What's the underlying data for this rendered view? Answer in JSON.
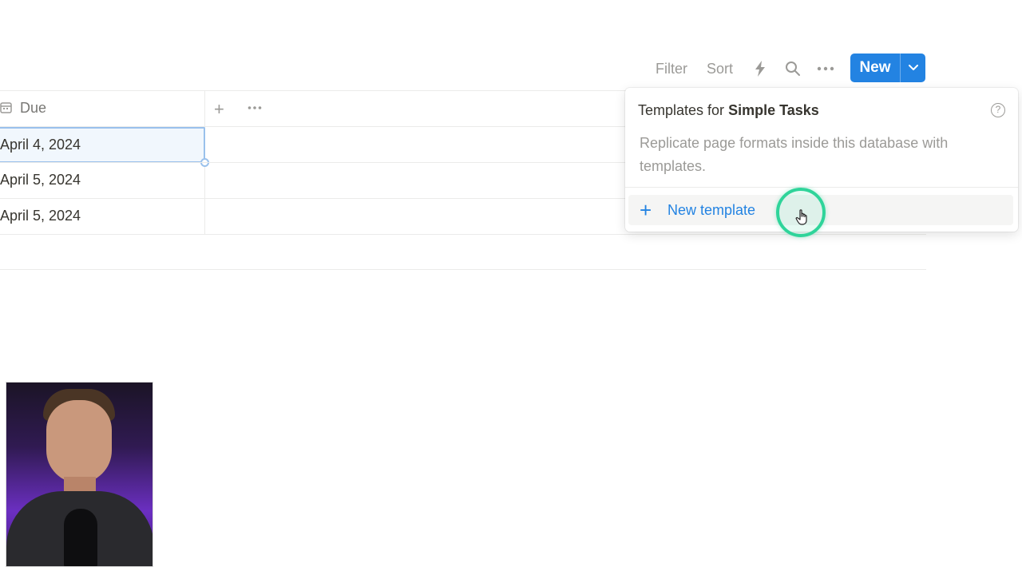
{
  "toolbar": {
    "filter_label": "Filter",
    "sort_label": "Sort",
    "icons": [
      "lightning-icon",
      "search-icon",
      "more-icon"
    ],
    "new_label": "New"
  },
  "table": {
    "header": {
      "property_label": "Due",
      "property_icon": "calendar-icon"
    },
    "rows": [
      {
        "due": "April 4, 2024"
      },
      {
        "due": "April 5, 2024"
      },
      {
        "due": "April 5, 2024"
      }
    ]
  },
  "templates_popup": {
    "title_prefix": "Templates for",
    "database_name": "Simple Tasks",
    "description": "Replicate page formats inside this database with templates.",
    "new_template_label": "New template"
  },
  "colors": {
    "accent": "#2383e2",
    "cursor_ring": "#2fd49a"
  }
}
